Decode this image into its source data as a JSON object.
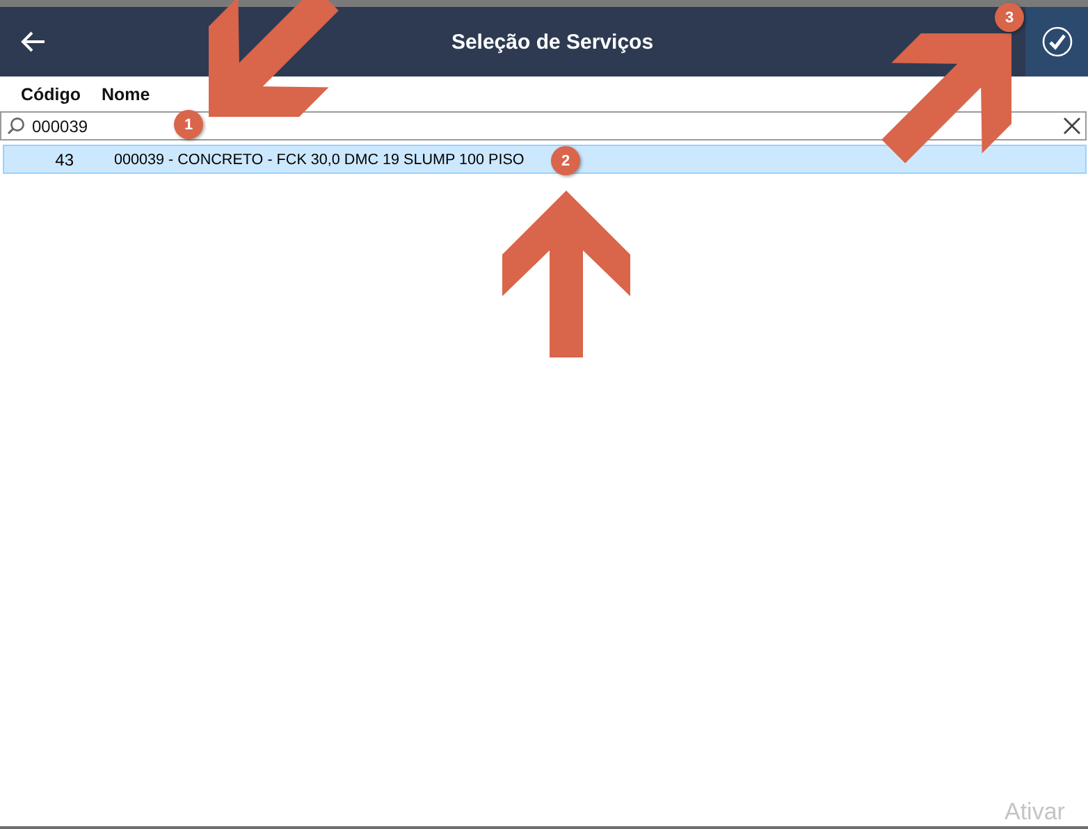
{
  "header": {
    "title": "Seleção de Serviços"
  },
  "columns": [
    "Código",
    "Nome"
  ],
  "search": {
    "value": "000039"
  },
  "rows": [
    {
      "code": "43",
      "name": "000039 - CONCRETO - FCK 30,0 DMC 19 SLUMP 100 PISO",
      "selected": true
    }
  ],
  "annotations": [
    {
      "label": "1"
    },
    {
      "label": "2"
    },
    {
      "label": "3"
    }
  ],
  "system_notice": {
    "text": "Ativar"
  }
}
